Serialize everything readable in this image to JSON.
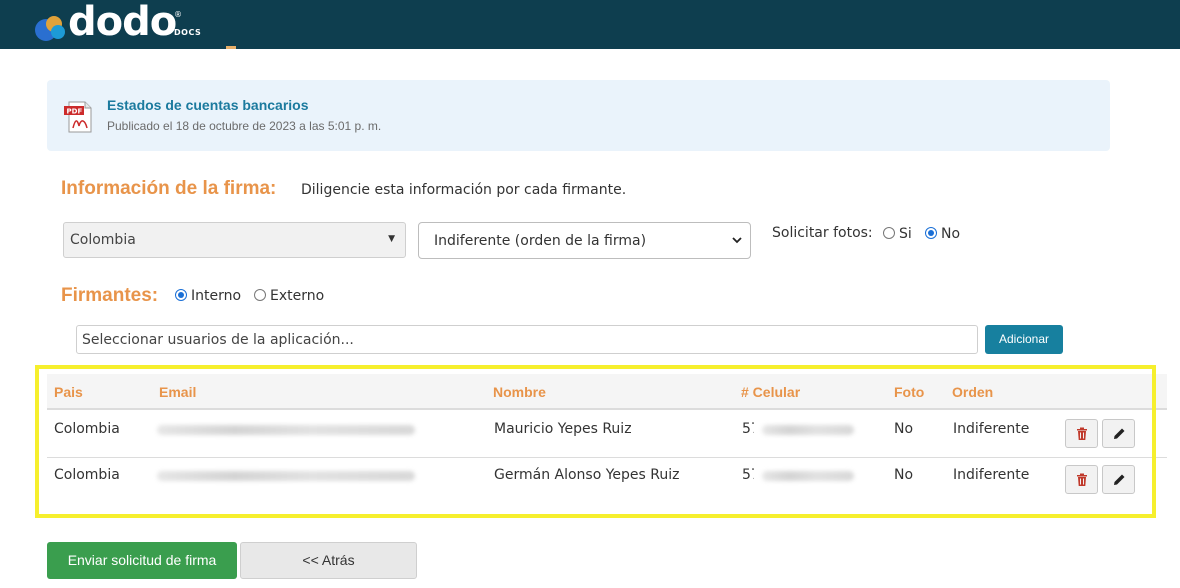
{
  "header": {
    "logo_text": "dodo",
    "logo_reg": "®",
    "logo_sub": "DOCS",
    "brand_color": "#0e3e4f"
  },
  "document": {
    "icon": "pdf-file-icon",
    "title": "Estados de cuentas bancarios",
    "published": "Publicado el 18 de octubre de 2023 a las 5:01 p. m."
  },
  "signature_info": {
    "title": "Información de la firma:",
    "note": "Diligencie esta información por cada firmante.",
    "country_select": "Colombia",
    "order_select": "Indiferente (orden de la firma)",
    "photos_label": "Solicitar fotos:",
    "photos_options": [
      {
        "label": "Si",
        "checked": false
      },
      {
        "label": "No",
        "checked": true
      }
    ]
  },
  "signers": {
    "title": "Firmantes:",
    "options": [
      {
        "label": "Interno",
        "checked": true
      },
      {
        "label": "Externo",
        "checked": false
      }
    ],
    "search_placeholder": "Seleccionar usuarios de la aplicación...",
    "add_button": "Adicionar"
  },
  "table": {
    "columns": [
      "Pais",
      "Email",
      "Nombre",
      "# Celular",
      "Foto",
      "Orden"
    ],
    "rows": [
      {
        "pais": "Colombia",
        "email": "",
        "nombre": "Mauricio Yepes Ruiz",
        "celular": "57",
        "foto": "No",
        "orden": "Indiferente"
      },
      {
        "pais": "Colombia",
        "email": "",
        "nombre": "Germán Alonso Yepes Ruiz",
        "celular": "57",
        "foto": "No",
        "orden": "Indiferente"
      }
    ],
    "header_color": "#e8944a",
    "highlight_color": "#f6ef2d"
  },
  "actions": {
    "send": "Enviar solicitud de firma",
    "back": "<< Atrás"
  }
}
